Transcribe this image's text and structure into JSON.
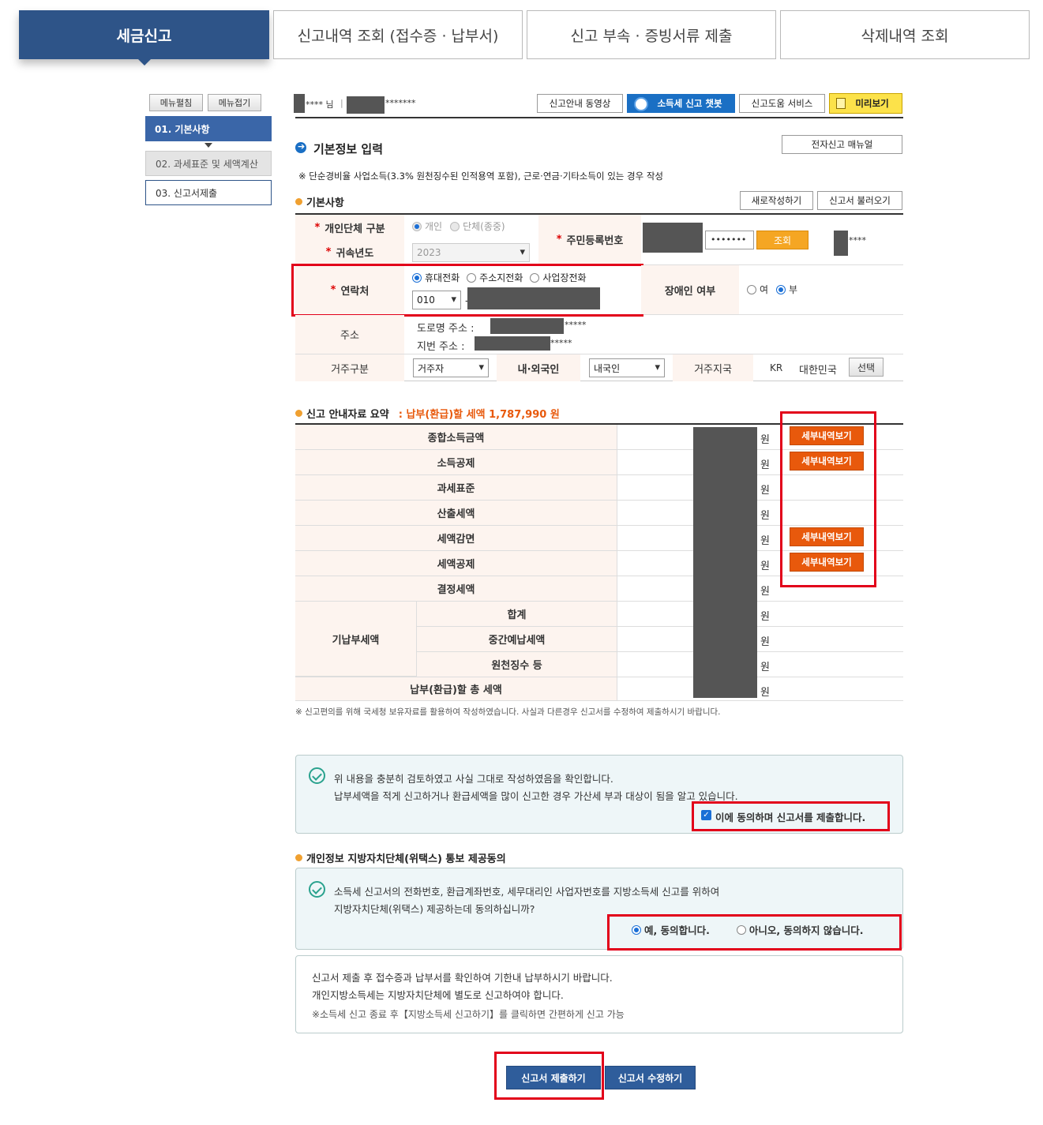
{
  "tabs": [
    "세금신고",
    "신고내역 조회 (접수증 · 납부서)",
    "신고 부속 · 증빙서류 제출",
    "삭제내역 조회"
  ],
  "side": {
    "expand": "메뉴펼침",
    "collapse": "메뉴접기",
    "items": [
      "01. 기본사항",
      "02. 과세표준 및 세액계산",
      "03. 신고서제출"
    ]
  },
  "header": {
    "user_suffix": "**** 님",
    "masked_id": "*******",
    "video": "신고안내 동영상",
    "chatbot": "소득세 신고 챗봇",
    "help": "신고도움 서비스",
    "preview": "미리보기"
  },
  "section_title": "기본정보 입력",
  "manual": "전자신고 매뉴얼",
  "note": "※ 단순경비율 사업소득(3.3% 원천징수된 인적용역 포함), 근로·연금·기타소득이 있는 경우 작성",
  "basic": {
    "title": "기본사항",
    "new": "새로작성하기",
    "load": "신고서 불러오기",
    "type_label": "개인단체 구분",
    "type_opts": [
      "개인",
      "단체(종중)"
    ],
    "year_label": "귀속년도",
    "year_value": "2023",
    "rrn_label": "주민등록번호",
    "rrn_masked": "•••••••",
    "rrn_btn": "조회",
    "rrn_tail": "****",
    "contact_label": "연락처",
    "contact_opts": [
      "휴대전화",
      "주소지전화",
      "사업장전화"
    ],
    "phone_prefix": "010",
    "dash": "-",
    "disabled_label": "장애인 여부",
    "disabled_opts": [
      "여",
      "부"
    ],
    "addr_label": "주소",
    "road": "도로명 주소 :",
    "jibun": "지번 주소 :",
    "road_mask": "*****",
    "jibun_mask": "*****",
    "res_label": "거주구분",
    "res_value": "거주자",
    "nat_label": "내·외국인",
    "nat_value": "내국인",
    "country_label": "거주지국",
    "country_code": "KR",
    "country_name": "대한민국",
    "choose": "선택"
  },
  "summary": {
    "title": "신고 안내자료 요약",
    "amount_text": ": 납부(환급)할 세액 1,787,990 원",
    "rows": [
      "종합소득금액",
      "소득공제",
      "과세표준",
      "산출세액",
      "세액감면",
      "세액공제",
      "결정세액"
    ],
    "prepaid": "기납부세액",
    "sub_rows": [
      "합계",
      "중간예납세액",
      "원천징수 등"
    ],
    "total": "납부(환급)할 총 세액",
    "unit": "원",
    "detail": "세부내역보기",
    "footnote": "※ 신고편의를 위해 국세청 보유자료를 활용하여 작성하였습니다. 사실과 다른경우 신고서를 수정하여 제출하시기 바랍니다."
  },
  "confirm": {
    "line1": "위 내용을 충분히 검토하였고 사실 그대로 작성하였음을 확인합니다.",
    "line2": "납부세액을 적게 신고하거나 환급세액을 많이 신고한 경우 가산세 부과 대상이 됨을 알고 있습니다.",
    "agree": "이에 동의하며 신고서를 제출합니다."
  },
  "privacy": {
    "title": "개인정보 지방자치단체(위택스) 통보 제공동의",
    "line1": "소득세 신고서의 전화번호, 환급계좌번호, 세무대리인 사업자번호를 지방소득세 신고를 위하여",
    "line2": "지방자치단체(위택스) 제공하는데 동의하십니까?",
    "yes": "예, 동의합니다.",
    "no": "아니오, 동의하지 않습니다."
  },
  "info": {
    "line1": "신고서 제출 후 접수증과 납부서를 확인하여 기한내 납부하시기 바랍니다.",
    "line2": "개인지방소득세는 지방자치단체에 별도로 신고하여야 합니다.",
    "line3": "※소득세 신고 종료 후【지방소득세 신고하기】를 클릭하면 간편하게 신고 가능"
  },
  "buttons": {
    "submit": "신고서 제출하기",
    "edit": "신고서 수정하기"
  }
}
